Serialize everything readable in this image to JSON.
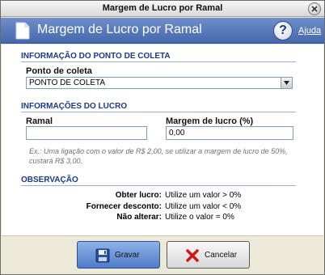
{
  "window": {
    "title": "Margem de Lucro por Ramal"
  },
  "banner": {
    "title": "Margem de Lucro por Ramal",
    "help_label": "Ajuda",
    "help_glyph": "?"
  },
  "sections": {
    "ponto_coleta": {
      "header": "INFORMAÇÃO DO PONTO DE COLETA",
      "field_label": "Ponto de coleta",
      "select_value": "PONTO DE COLETA"
    },
    "lucro": {
      "header": "INFORMAÇÕES DO LUCRO",
      "ramal_label": "Ramal",
      "ramal_value": "",
      "margem_label": "Margem de lucro (%)",
      "margem_value": "0,00",
      "example_text": "Ex.: Uma ligação com o valor de R$ 2,00, se utilizar a margem de lucro de 50%, custará R$ 3,00."
    },
    "observacao": {
      "header": "OBSERVAÇÃO",
      "rows": [
        {
          "label": "Obter lucro:",
          "value": "Utilize um valor > 0%"
        },
        {
          "label": "Fornecer desconto:",
          "value": "Utilize um valor < 0%"
        },
        {
          "label": "Não alterar:",
          "value": "Utilize o valor = 0%"
        }
      ]
    }
  },
  "buttons": {
    "save_label": "Gravar",
    "cancel_label": "Cancelar"
  },
  "icons": {
    "close": "close-icon",
    "document": "document-icon",
    "help": "help-icon",
    "dropdown": "chevron-down-icon",
    "save": "floppy-disk-icon",
    "cancel": "red-x-icon"
  },
  "colors": {
    "banner": "#4f72b5",
    "section_header": "#1a3a8a",
    "save_button": "#6b93d6"
  }
}
